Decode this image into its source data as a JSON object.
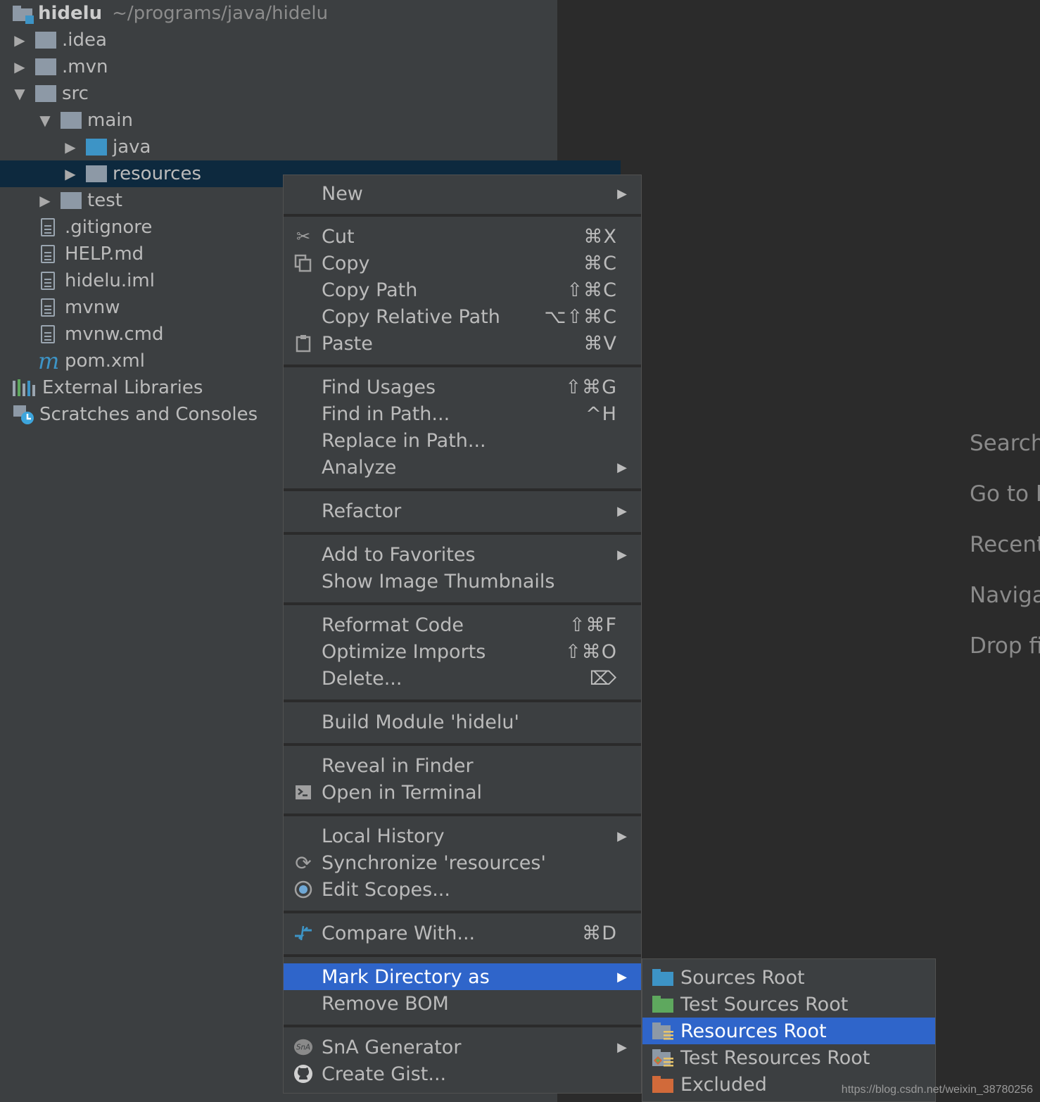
{
  "project": {
    "name": "hidelu",
    "path": "~/programs/java/hidelu",
    "items": [
      {
        "label": ".idea"
      },
      {
        "label": ".mvn"
      },
      {
        "label": "src"
      },
      {
        "label": "main"
      },
      {
        "label": "java"
      },
      {
        "label": "resources"
      },
      {
        "label": "test"
      },
      {
        "label": ".gitignore"
      },
      {
        "label": "HELP.md"
      },
      {
        "label": "hidelu.iml"
      },
      {
        "label": "mvnw"
      },
      {
        "label": "mvnw.cmd"
      },
      {
        "label": "pom.xml"
      },
      {
        "label": "External Libraries"
      },
      {
        "label": "Scratches and Consoles"
      }
    ]
  },
  "editor_hints": [
    "Search",
    "Go to F",
    "Recent",
    "Naviga",
    "Drop fi"
  ],
  "menu": {
    "items": [
      {
        "label": "New",
        "shortcut": "",
        "icon": ""
      },
      {
        "label": "Cut",
        "shortcut": "⌘X",
        "icon": "scissors-icon"
      },
      {
        "label": "Copy",
        "shortcut": "⌘C",
        "icon": "copy-icon"
      },
      {
        "label": "Copy Path",
        "shortcut": "⇧⌘C",
        "icon": ""
      },
      {
        "label": "Copy Relative Path",
        "shortcut": "⌥⇧⌘C",
        "icon": ""
      },
      {
        "label": "Paste",
        "shortcut": "⌘V",
        "icon": "clipboard-icon"
      },
      {
        "label": "Find Usages",
        "shortcut": "⇧⌘G",
        "icon": ""
      },
      {
        "label": "Find in Path...",
        "shortcut": "^H",
        "icon": ""
      },
      {
        "label": "Replace in Path...",
        "shortcut": "",
        "icon": ""
      },
      {
        "label": "Analyze",
        "shortcut": "",
        "icon": ""
      },
      {
        "label": "Refactor",
        "shortcut": "",
        "icon": ""
      },
      {
        "label": "Add to Favorites",
        "shortcut": "",
        "icon": ""
      },
      {
        "label": "Show Image Thumbnails",
        "shortcut": "",
        "icon": ""
      },
      {
        "label": "Reformat Code",
        "shortcut": "⇧⌘F",
        "icon": ""
      },
      {
        "label": "Optimize Imports",
        "shortcut": "⇧⌘O",
        "icon": ""
      },
      {
        "label": "Delete...",
        "shortcut": "⌦",
        "icon": ""
      },
      {
        "label": "Build Module 'hidelu'",
        "shortcut": "",
        "icon": ""
      },
      {
        "label": "Reveal in Finder",
        "shortcut": "",
        "icon": ""
      },
      {
        "label": "Open in Terminal",
        "shortcut": "",
        "icon": "terminal-icon"
      },
      {
        "label": "Local History",
        "shortcut": "",
        "icon": ""
      },
      {
        "label": "Synchronize 'resources'",
        "shortcut": "",
        "icon": "sync-icon"
      },
      {
        "label": "Edit Scopes...",
        "shortcut": "",
        "icon": "scope-icon"
      },
      {
        "label": "Compare With...",
        "shortcut": "⌘D",
        "icon": "compare-icon"
      },
      {
        "label": "Mark Directory as",
        "shortcut": "",
        "icon": ""
      },
      {
        "label": "Remove BOM",
        "shortcut": "",
        "icon": ""
      },
      {
        "label": "SnA Generator",
        "shortcut": "",
        "icon": "sna-icon"
      },
      {
        "label": "Create Gist...",
        "shortcut": "",
        "icon": "github-icon"
      }
    ]
  },
  "submenu": {
    "items": [
      {
        "label": "Sources Root",
        "color": "#3d94c6"
      },
      {
        "label": "Test Sources Root",
        "color": "#5ea85e"
      },
      {
        "label": "Resources Root",
        "color": "#8d99a6"
      },
      {
        "label": "Test Resources Root",
        "color": "#8d99a6"
      },
      {
        "label": "Excluded",
        "color": "#d16a3a"
      }
    ]
  },
  "watermark": "https://blog.csdn.net/weixin_38780256"
}
